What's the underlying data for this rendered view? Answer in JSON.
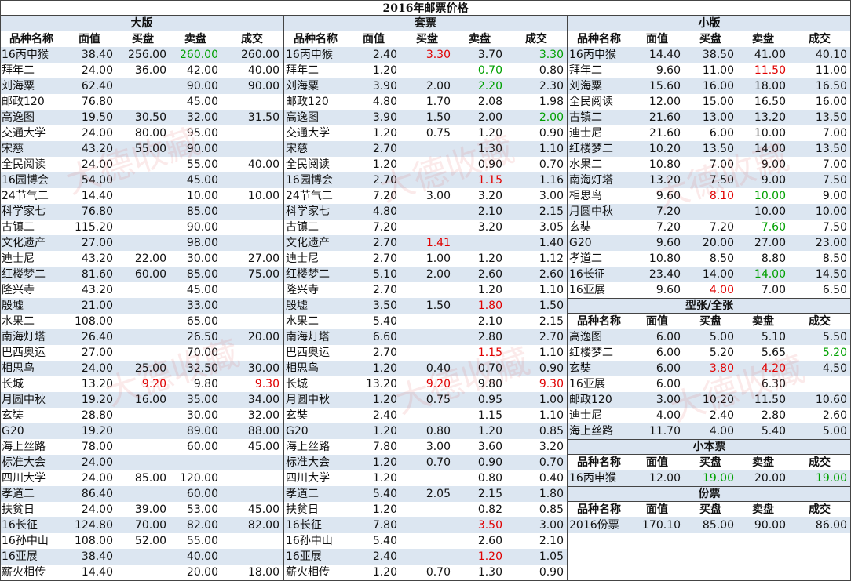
{
  "title": "2016年邮票价格",
  "columns": [
    "品种名称",
    "面值",
    "买盘",
    "卖盘",
    "成交"
  ],
  "sections": [
    {
      "id": "daban",
      "label": "大版",
      "rows": [
        [
          "16丙申猴",
          "38.40",
          "256.00",
          "260.00",
          "260.00"
        ],
        [
          "拜年二",
          "24.00",
          "36.00",
          "42.00",
          "40.00"
        ],
        [
          "刘海粟",
          "62.40",
          "",
          "90.00",
          "90.00"
        ],
        [
          "邮政120",
          "76.80",
          "",
          "45.00",
          ""
        ],
        [
          "高逸图",
          "19.50",
          "30.50",
          "32.00",
          "31.50"
        ],
        [
          "交通大学",
          "24.00",
          "80.00",
          "95.00",
          ""
        ],
        [
          "宋慈",
          "43.20",
          "55.00",
          "90.00",
          ""
        ],
        [
          "全民阅读",
          "24.00",
          "",
          "55.00",
          "40.00"
        ],
        [
          "16园博会",
          "54.00",
          "",
          "45.00",
          ""
        ],
        [
          "24节气二",
          "14.40",
          "",
          "10.00",
          "10.00"
        ],
        [
          "科学家七",
          "76.80",
          "",
          "85.00",
          ""
        ],
        [
          "古镇二",
          "115.20",
          "",
          "90.00",
          ""
        ],
        [
          "文化遗产",
          "27.00",
          "",
          "98.00",
          ""
        ],
        [
          "迪士尼",
          "43.20",
          "22.00",
          "30.00",
          "27.00"
        ],
        [
          "红楼梦二",
          "81.60",
          "60.00",
          "85.00",
          "75.00"
        ],
        [
          "隆兴寺",
          "43.20",
          "",
          "45.00",
          ""
        ],
        [
          "殷墟",
          "21.00",
          "",
          "33.00",
          ""
        ],
        [
          "水果二",
          "108.00",
          "",
          "65.00",
          ""
        ],
        [
          "南海灯塔",
          "26.40",
          "",
          "26.50",
          "20.00"
        ],
        [
          "巴西奥运",
          "27.00",
          "",
          "70.00",
          ""
        ],
        [
          "相思鸟",
          "24.00",
          "25.00",
          "32.50",
          "30.00"
        ],
        [
          "长城",
          "13.20",
          "9.20",
          "9.80",
          "9.30"
        ],
        [
          "月圆中秋",
          "19.20",
          "16.00",
          "35.00",
          "34.00"
        ],
        [
          "玄奘",
          "28.80",
          "",
          "30.00",
          "32.00"
        ],
        [
          "G20",
          "19.20",
          "",
          "89.00",
          "88.00"
        ],
        [
          "海上丝路",
          "78.00",
          "",
          "60.00",
          "45.00"
        ],
        [
          "标准大会",
          "24.00",
          "",
          "",
          ""
        ],
        [
          "四川大学",
          "24.00",
          "85.00",
          "120.00",
          ""
        ],
        [
          "孝道二",
          "86.40",
          "",
          "60.00",
          ""
        ],
        [
          "扶贫日",
          "24.00",
          "39.00",
          "53.00",
          "45.00"
        ],
        [
          "16长征",
          "124.80",
          "70.00",
          "82.00",
          "82.00"
        ],
        [
          "16孙中山",
          "108.00",
          "52.00",
          "55.00",
          ""
        ],
        [
          "16亚展",
          "38.40",
          "",
          "40.00",
          ""
        ],
        [
          "薪火相传",
          "14.40",
          "",
          "20.00",
          "18.00"
        ]
      ],
      "colors": {
        "0-3": "green",
        "21-2": "red",
        "21-4": "red"
      }
    },
    {
      "id": "taopiao",
      "label": "套票",
      "rows": [
        [
          "16丙申猴",
          "2.40",
          "3.30",
          "3.70",
          "3.30"
        ],
        [
          "拜年二",
          "1.20",
          "",
          "0.70",
          "0.80"
        ],
        [
          "刘海粟",
          "3.90",
          "2.00",
          "2.20",
          "2.30"
        ],
        [
          "邮政120",
          "4.80",
          "1.70",
          "2.08",
          "1.98"
        ],
        [
          "高逸图",
          "3.90",
          "1.50",
          "2.00",
          "2.00"
        ],
        [
          "交通大学",
          "1.20",
          "0.75",
          "1.20",
          "0.90"
        ],
        [
          "宋慈",
          "2.70",
          "",
          "1.30",
          "1.10"
        ],
        [
          "全民阅读",
          "1.20",
          "",
          "0.90",
          "0.70"
        ],
        [
          "16园博会",
          "2.70",
          "",
          "1.15",
          "1.16"
        ],
        [
          "24节气二",
          "7.20",
          "3.00",
          "3.20",
          "3.00"
        ],
        [
          "科学家七",
          "4.80",
          "",
          "2.10",
          "2.15"
        ],
        [
          "古镇二",
          "7.20",
          "",
          "3.20",
          "3.05"
        ],
        [
          "文化遗产",
          "2.70",
          "1.41",
          "",
          "1.40"
        ],
        [
          "迪士尼",
          "2.70",
          "1.00",
          "1.20",
          "1.12"
        ],
        [
          "红楼梦二",
          "5.10",
          "2.00",
          "2.60",
          "2.60"
        ],
        [
          "隆兴寺",
          "2.70",
          "",
          "1.20",
          "1.10"
        ],
        [
          "殷墟",
          "3.50",
          "1.50",
          "1.80",
          "1.50"
        ],
        [
          "水果二",
          "5.40",
          "",
          "2.10",
          "2.15"
        ],
        [
          "南海灯塔",
          "6.60",
          "",
          "2.80",
          "2.70"
        ],
        [
          "巴西奥运",
          "2.70",
          "",
          "1.15",
          "1.10"
        ],
        [
          "相思鸟",
          "1.20",
          "0.40",
          "0.70",
          "0.90"
        ],
        [
          "长城",
          "13.20",
          "9.20",
          "9.80",
          "9.30"
        ],
        [
          "月圆中秋",
          "1.20",
          "0.75",
          "0.95",
          "1.00"
        ],
        [
          "玄奘",
          "2.40",
          "",
          "1.15",
          "1.10"
        ],
        [
          "G20",
          "1.20",
          "0.80",
          "1.20",
          "0.85"
        ],
        [
          "海上丝路",
          "7.80",
          "3.00",
          "3.60",
          "3.20"
        ],
        [
          "标准大会",
          "1.20",
          "0.70",
          "0.90",
          "0.70"
        ],
        [
          "四川大学",
          "1.20",
          "",
          "0.80",
          "0.40"
        ],
        [
          "孝道二",
          "5.40",
          "2.05",
          "2.15",
          "1.80"
        ],
        [
          "扶贫日",
          "1.20",
          "",
          "0.82",
          "0.85"
        ],
        [
          "16长征",
          "7.80",
          "",
          "3.50",
          "3.00"
        ],
        [
          "16孙中山",
          "5.40",
          "",
          "2.60",
          "2.10"
        ],
        [
          "16亚展",
          "2.40",
          "",
          "1.20",
          "1.05"
        ],
        [
          "薪火相传",
          "1.20",
          "0.70",
          "1.30",
          "0.90"
        ]
      ],
      "colors": {
        "0-2": "red",
        "0-4": "green",
        "1-3": "green",
        "2-3": "green",
        "4-4": "green",
        "8-3": "red",
        "12-2": "red",
        "16-3": "red",
        "19-3": "red",
        "21-2": "red",
        "21-4": "red",
        "30-3": "red",
        "32-3": "red"
      }
    },
    {
      "id": "xiaoban",
      "label": "小版",
      "rows": [
        [
          "16丙申猴",
          "14.40",
          "38.50",
          "41.00",
          "40.10"
        ],
        [
          "拜年二",
          "9.60",
          "11.00",
          "11.50",
          "11.00"
        ],
        [
          "刘海粟",
          "15.60",
          "16.00",
          "18.00",
          "16.50"
        ],
        [
          "全民阅读",
          "12.00",
          "15.00",
          "16.50",
          "16.00"
        ],
        [
          "古镇二",
          "21.60",
          "13.00",
          "13.20",
          "13.50"
        ],
        [
          "迪士尼",
          "21.60",
          "6.00",
          "10.00",
          "7.00"
        ],
        [
          "红楼梦二",
          "10.20",
          "13.50",
          "14.00",
          "13.50"
        ],
        [
          "水果二",
          "10.80",
          "7.00",
          "9.00",
          "7.00"
        ],
        [
          "南海灯塔",
          "13.20",
          "7.50",
          "9.00",
          "7.50"
        ],
        [
          "相思鸟",
          "9.60",
          "8.10",
          "10.00",
          "9.00"
        ],
        [
          "月圆中秋",
          "7.20",
          "",
          "10.00",
          "10.00"
        ],
        [
          "玄奘",
          "7.20",
          "7.20",
          "7.60",
          "7.50"
        ],
        [
          "G20",
          "9.60",
          "20.00",
          "27.00",
          "23.00"
        ],
        [
          "孝道二",
          "10.80",
          "8.50",
          "8.80",
          "8.50"
        ],
        [
          "16长征",
          "23.40",
          "14.00",
          "14.00",
          "14.50"
        ],
        [
          "16亚展",
          "9.60",
          "4.00",
          "7.00",
          "6.50"
        ]
      ],
      "colors": {
        "1-3": "red",
        "9-2": "red",
        "9-3": "green",
        "11-3": "green",
        "14-3": "green",
        "15-2": "red"
      }
    },
    {
      "id": "xingzhang",
      "label": "型张/全张",
      "rows": [
        [
          "高逸图",
          "6.00",
          "5.00",
          "5.10",
          "5.50"
        ],
        [
          "红楼梦二",
          "6.00",
          "5.20",
          "5.65",
          "5.20"
        ],
        [
          "玄奘",
          "6.00",
          "3.80",
          "4.20",
          "4.50"
        ],
        [
          "16亚展",
          "6.00",
          "",
          "6.30",
          ""
        ],
        [
          "邮政120",
          "3.00",
          "10.20",
          "11.50",
          "10.60"
        ],
        [
          "迪士尼",
          "4.00",
          "2.40",
          "2.80",
          "2.60"
        ],
        [
          "海上丝路",
          "11.70",
          "4.00",
          "5.40",
          "5.00"
        ]
      ],
      "colors": {
        "1-4": "green",
        "2-2": "red",
        "2-3": "red"
      }
    },
    {
      "id": "xiaobenpiao",
      "label": "小本票",
      "rows": [
        [
          "16丙申猴",
          "12.00",
          "19.00",
          "20.00",
          "19.00"
        ]
      ],
      "colors": {
        "0-2": "green",
        "0-4": "green"
      }
    },
    {
      "id": "fenpiao",
      "label": "份票",
      "rows": [
        [
          "2016份票",
          "170.10",
          "85.00",
          "90.00",
          "86.00"
        ]
      ],
      "colors": {}
    }
  ],
  "watermark": "大德收藏"
}
